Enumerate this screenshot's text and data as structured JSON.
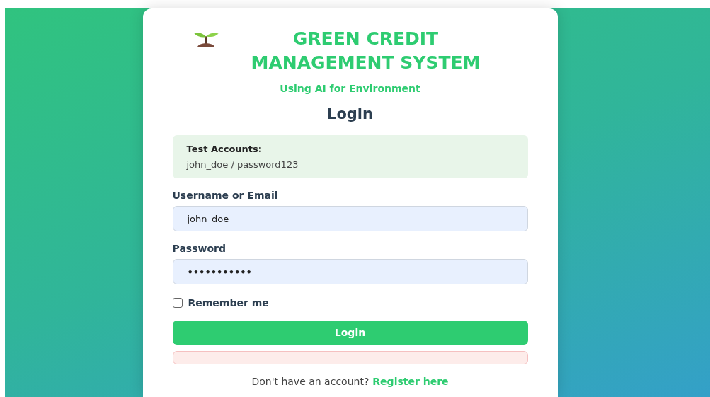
{
  "header": {
    "title": "GREEN CREDIT MANAGEMENT SYSTEM",
    "subtitle": "Using AI for Environment"
  },
  "form": {
    "heading": "Login",
    "info": {
      "title": "Test Accounts:",
      "text": "john_doe / password123"
    },
    "fields": [
      {
        "label": "Username or Email",
        "value": "john_doe",
        "kind": "text"
      },
      {
        "label": "Password",
        "value": "•••••••••••",
        "kind": "password"
      }
    ],
    "remember": {
      "label": "Remember me",
      "checked": false
    },
    "submit": "Login",
    "error_alert": {
      "visible": true
    },
    "footer": {
      "text": "Don't have an account?",
      "link": "Register here"
    }
  }
}
